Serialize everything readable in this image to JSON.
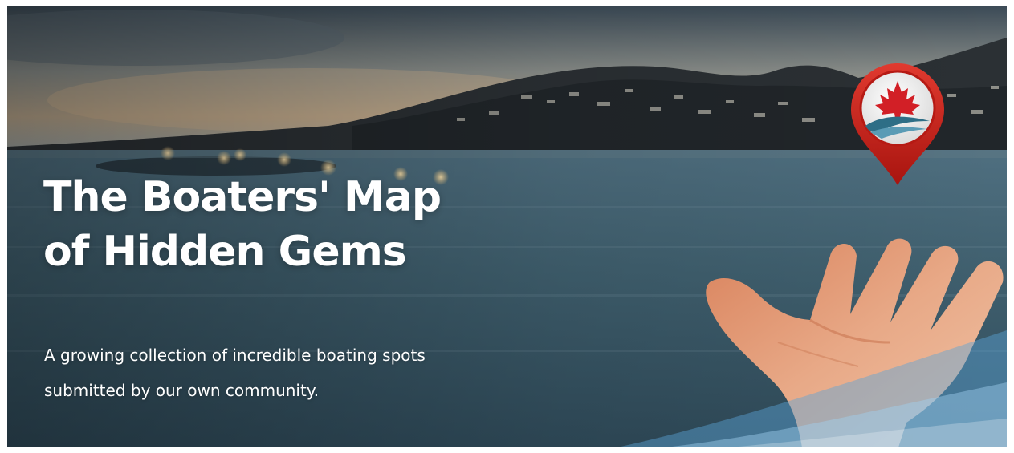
{
  "hero": {
    "title_lines": [
      "The Boaters' Map",
      "of Hidden Gems"
    ],
    "subtitle_lines": [
      "A growing collection of incredible boating spots",
      "submitted by our own community."
    ]
  },
  "icons": {
    "map_pin": "maple-leaf-map-pin-icon",
    "hand": "open-hand-illustration"
  },
  "colors": {
    "pin_red": "#c8201c",
    "leaf_red": "#d21f26",
    "wave_teal": "#2e6e86",
    "water": "#3f6074",
    "text": "#ffffff"
  }
}
